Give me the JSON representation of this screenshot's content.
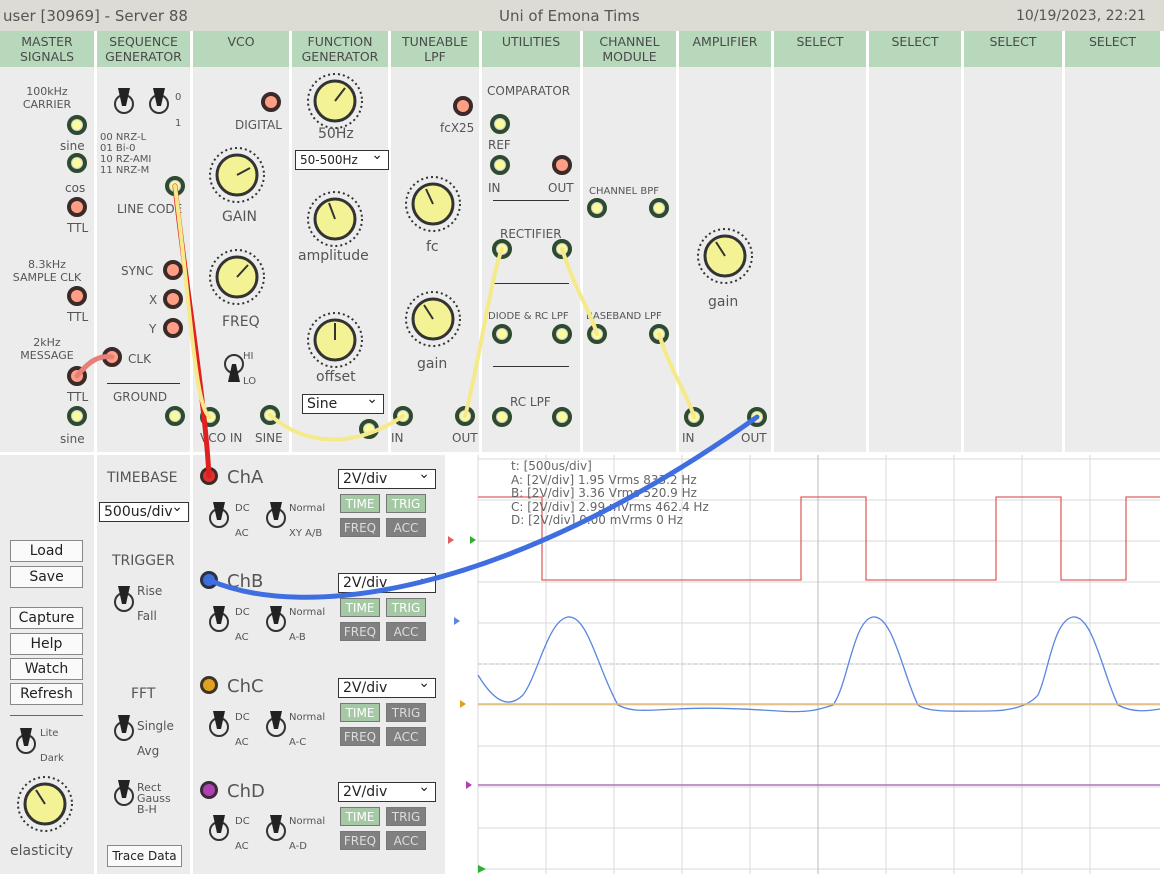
{
  "header": {
    "user": "user [30969] - Server 88",
    "title": "Uni of Emona Tims",
    "datetime": "10/19/2023, 22:21"
  },
  "modules": [
    "MASTER\nSIGNALS",
    "SEQUENCE\nGENERATOR",
    "VCO",
    "FUNCTION\nGENERATOR",
    "TUNEABLE\nLPF",
    "UTILITIES",
    "CHANNEL\nMODULE",
    "AMPLIFIER",
    "SELECT",
    "SELECT",
    "SELECT",
    "SELECT"
  ],
  "master": {
    "carrier": "100kHz\nCARRIER",
    "sine": "sine",
    "cos": "cos",
    "ttl": "TTL",
    "sample": "8.3kHz\nSAMPLE CLK",
    "sample_ttl": "TTL",
    "message": "2kHz\nMESSAGE",
    "msg_ttl": "TTL",
    "msg_sine": "sine"
  },
  "seqgen": {
    "bit0": "0",
    "bit1": "1",
    "codes": "00 NRZ-L\n01 Bi-0\n10 RZ-AMI\n11 NRZ-M",
    "line_code": "LINE CODE",
    "sync": "SYNC",
    "x": "X",
    "y": "Y",
    "clk": "CLK",
    "ground": "GROUND"
  },
  "vco": {
    "digital": "DIGITAL",
    "gain": "GAIN",
    "freq": "FREQ",
    "hi": "HI",
    "lo": "LO",
    "vco_in": "VCO IN",
    "sine": "SINE"
  },
  "funcgen": {
    "freq": "50Hz",
    "range": "50-500Hz",
    "amplitude": "amplitude",
    "offset": "offset",
    "wave": "Sine"
  },
  "lpf": {
    "fcx": "fcX25",
    "fc": "fc",
    "gain": "gain",
    "in": "IN",
    "out": "OUT"
  },
  "utilities": {
    "comparator": "COMPARATOR",
    "ref": "REF",
    "in": "IN",
    "out": "OUT",
    "rectifier": "RECTIFIER",
    "diode": "DIODE & RC LPF",
    "rclpf": "RC LPF"
  },
  "channel": {
    "bpf": "CHANNEL BPF",
    "baseband": "BASEBAND LPF"
  },
  "amplifier": {
    "gain": "gain",
    "in": "IN",
    "out": "OUT"
  },
  "controls": {
    "load": "Load",
    "save": "Save",
    "capture": "Capture",
    "help": "Help",
    "watch": "Watch",
    "refresh": "Refresh",
    "lite": "Lite",
    "dark": "Dark",
    "elasticity": "elasticity"
  },
  "scope": {
    "timebase_label": "TIMEBASE",
    "timebase": "500us/div",
    "trigger": "TRIGGER",
    "rise": "Rise",
    "fall": "Fall",
    "fft": "FFT",
    "single": "Single",
    "avg": "Avg",
    "window": "Rect\nGauss\nB-H",
    "trace_data": "Trace Data",
    "dc": "DC",
    "ac": "AC",
    "normal": "Normal",
    "time": "TIME",
    "trig": "TRIG",
    "freq": "FREQ",
    "acc": "ACC",
    "channels": [
      {
        "name": "ChA",
        "vdiv": "2V/div",
        "mode": "XY A/B",
        "color": "#e03030"
      },
      {
        "name": "ChB",
        "vdiv": "2V/div",
        "mode": "A-B",
        "color": "#3a6fd8"
      },
      {
        "name": "ChC",
        "vdiv": "2V/div",
        "mode": "A-C",
        "color": "#e0a020"
      },
      {
        "name": "ChD",
        "vdiv": "2V/div",
        "mode": "A-D",
        "color": "#b040b0"
      }
    ],
    "readout": [
      "t: [500us/div]",
      "A: [2V/div] 1.95 Vrms  833.2 Hz",
      "B: [2V/div] 3.36 Vrms  520.9 Hz",
      "C: [2V/div] 2.99 mVrms  462.4 Hz",
      "D: [2V/div] 0.00 mVrms  0 Hz"
    ]
  }
}
